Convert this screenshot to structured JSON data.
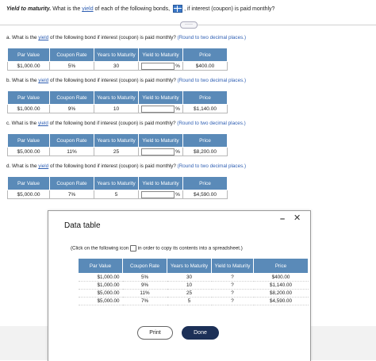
{
  "header": {
    "title": "Yield to maturity.",
    "text1": " What is the ",
    "link": "yield",
    "text2": " of each of the following bonds, ",
    "text3": ", if interest (coupon) is paid monthly?"
  },
  "more_label": "·····",
  "questions": [
    {
      "prefix": "a. What is the ",
      "link": "yield",
      "text": " of the following bond if interest (coupon) is paid monthly?",
      "hint": "(Round to two decimal places.)",
      "headers": [
        "Par Value",
        "Coupon Rate",
        "Years to Maturity",
        "Yield to Maturity",
        "Price"
      ],
      "row": [
        "$1,000.00",
        "5%",
        "30",
        "%",
        "$400.00"
      ]
    },
    {
      "prefix": "b. What is the ",
      "link": "yield",
      "text": " of the following bond if interest (coupon) is paid monthly?",
      "hint": "(Round to two decimal places.)",
      "headers": [
        "Par Value",
        "Coupon Rate",
        "Years to Maturity",
        "Yield to Maturity",
        "Price"
      ],
      "row": [
        "$1,000.00",
        "9%",
        "10",
        "%",
        "$1,140.00"
      ]
    },
    {
      "prefix": "c. What is the ",
      "link": "yield",
      "text": " of the following bond if interest (coupon) is paid monthly?",
      "hint": "(Round to two decimal places.)",
      "headers": [
        "Par Value",
        "Coupon Rate",
        "Years to Maturity",
        "Yield to Maturity",
        "Price"
      ],
      "row": [
        "$5,000.00",
        "11%",
        "25",
        "%",
        "$8,200.00"
      ]
    },
    {
      "prefix": "d. What is the ",
      "link": "yield",
      "text": " of the following bond if interest (coupon) is paid monthly?",
      "hint": "(Round to two decimal places.)",
      "headers": [
        "Par Value",
        "Coupon Rate",
        "Years to Maturity",
        "Yield to Maturity",
        "Price"
      ],
      "row": [
        "$5,000.00",
        "7%",
        "5",
        "%",
        "$4,590.00"
      ]
    }
  ],
  "modal": {
    "title": "Data table",
    "hint_before": "(Click on the following icon ",
    "hint_after": " in order to copy its contents into a spreadsheet.)",
    "headers": [
      "Par Value",
      "Coupon Rate",
      "Years to Maturity",
      "Yield to Maturity",
      "Price"
    ],
    "rows": [
      [
        "$1,000.00",
        "5%",
        "30",
        "?",
        "$400.00"
      ],
      [
        "$1,000.00",
        "9%",
        "10",
        "?",
        "$1,140.00"
      ],
      [
        "$5,000.00",
        "11%",
        "25",
        "?",
        "$8,200.00"
      ],
      [
        "$5,000.00",
        "7%",
        "5",
        "?",
        "$4,590.00"
      ]
    ],
    "print_label": "Print",
    "done_label": "Done",
    "minimize_label": "–",
    "close_label": "✕"
  }
}
